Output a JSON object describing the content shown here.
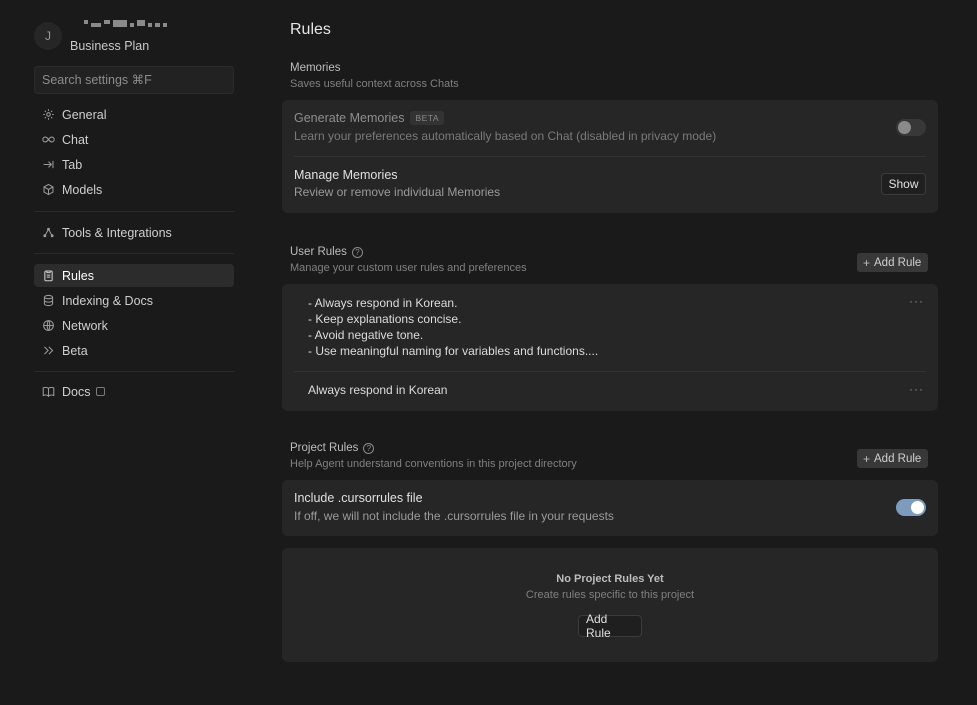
{
  "sidebar": {
    "avatar_initial": "J",
    "plan": "Business Plan",
    "search_placeholder": "Search settings ⌘F",
    "items": [
      {
        "label": "General",
        "icon": "gear-icon"
      },
      {
        "label": "Chat",
        "icon": "infinity-icon"
      },
      {
        "label": "Tab",
        "icon": "arrow-right-bar-icon"
      },
      {
        "label": "Models",
        "icon": "cube-icon"
      },
      {
        "label": "Tools & Integrations",
        "icon": "network-nodes-icon"
      },
      {
        "label": "Rules",
        "icon": "clipboard-icon",
        "active": true
      },
      {
        "label": "Indexing & Docs",
        "icon": "database-icon"
      },
      {
        "label": "Network",
        "icon": "globe-icon"
      },
      {
        "label": "Beta",
        "icon": "double-chevron-icon"
      },
      {
        "label": "Docs",
        "icon": "book-icon"
      }
    ]
  },
  "main": {
    "title": "Rules",
    "memories": {
      "title": "Memories",
      "subtitle": "Saves useful context across Chats",
      "generate": {
        "title": "Generate Memories",
        "badge": "BETA",
        "subtitle": "Learn your preferences automatically based on Chat (disabled in privacy mode)",
        "enabled": false
      },
      "manage": {
        "title": "Manage Memories",
        "subtitle": "Review or remove individual Memories",
        "button": "Show"
      }
    },
    "user_rules": {
      "title": "User Rules",
      "subtitle": "Manage your custom user rules and preferences",
      "add_button": "Add Rule",
      "rules": [
        {
          "lines": [
            "- Always respond in Korean.",
            "- Keep explanations concise.",
            "- Avoid negative tone.",
            "- Use meaningful naming for variables and functions...."
          ]
        },
        {
          "lines": [
            "Always respond in Korean"
          ]
        }
      ],
      "more": "···"
    },
    "project_rules": {
      "title": "Project Rules",
      "subtitle": "Help Agent understand conventions in this project directory",
      "add_button": "Add Rule",
      "cursorrules": {
        "title": "Include .cursorrules file",
        "subtitle": "If off, we will not include the .cursorrules file in your requests",
        "enabled": true
      },
      "empty": {
        "title": "No Project Rules Yet",
        "subtitle": "Create rules specific to this project",
        "button": "Add Rule"
      }
    }
  }
}
